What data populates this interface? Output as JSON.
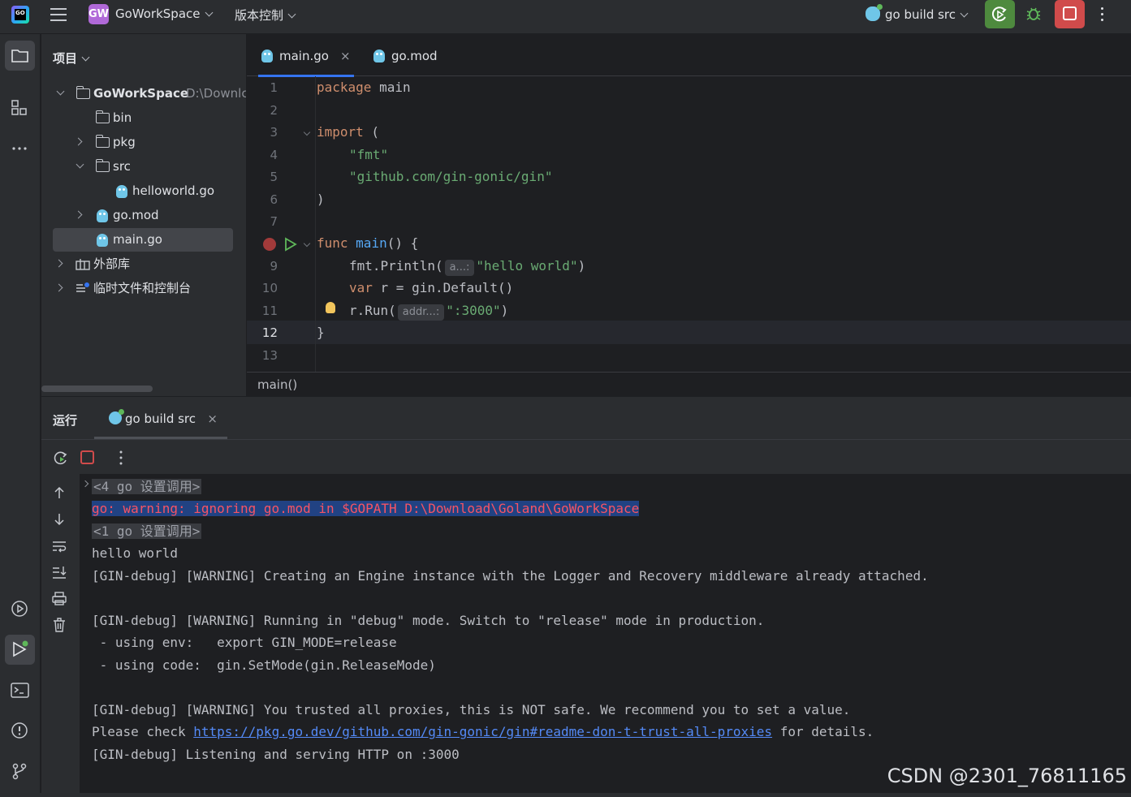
{
  "topbar": {
    "app_logo_text": "GO",
    "project_badge": "GW",
    "project_name": "GoWorkSpace",
    "vcs_menu": "版本控制",
    "run_config": "go build src"
  },
  "sidebar_left": {
    "icons": [
      "folder-icon",
      "structure-icon",
      "more-icon",
      "services-icon",
      "run-icon",
      "terminal-icon",
      "problems-icon",
      "git-icon"
    ]
  },
  "project_panel": {
    "title": "项目",
    "tree": [
      {
        "label": "GoWorkSpace",
        "hint": "D:\\Downlc",
        "type": "folder",
        "expanded": true
      },
      {
        "label": "bin",
        "type": "folder"
      },
      {
        "label": "pkg",
        "type": "folder",
        "collapsed": true
      },
      {
        "label": "src",
        "type": "folder",
        "expanded": true
      },
      {
        "label": "helloworld.go",
        "type": "gofile"
      },
      {
        "label": "go.mod",
        "type": "gomod",
        "collapsed": true
      },
      {
        "label": "main.go",
        "type": "gofile",
        "selected": true
      },
      {
        "label": "外部库",
        "type": "library"
      },
      {
        "label": "临时文件和控制台",
        "type": "scratch"
      }
    ]
  },
  "editor": {
    "tabs": [
      {
        "label": "main.go",
        "close": "×",
        "active": true
      },
      {
        "label": "go.mod",
        "active": false
      }
    ],
    "line_numbers": [
      "1",
      "2",
      "3",
      "4",
      "5",
      "6",
      "7",
      "8",
      "9",
      "10",
      "11",
      "12",
      "13"
    ],
    "code": {
      "l1_kw": "package",
      "l1_name": " main",
      "l3_kw": "import",
      "l3_rest": " (",
      "l4": "\"fmt\"",
      "l5": "\"github.com/gin-gonic/gin\"",
      "l6": ")",
      "l8_kw": "func",
      "l8_fn": "main",
      "l8_rest": "() {",
      "l9_call": "fmt.Println(",
      "l9_hint": "a...:",
      "l9_str": "\"hello world\"",
      "l9_end": ")",
      "l10_kw": "var",
      "l10_rest": " r = gin.Default()",
      "l11_call": "r.Run(",
      "l11_hint": "addr...:",
      "l11_str": "\":3000\"",
      "l11_end": ")",
      "l12": "}"
    },
    "breadcrumb": "main()"
  },
  "run_panel": {
    "title": "运行",
    "tab_label": "go build src",
    "tab_close": "×",
    "console": {
      "fold1": "<4 go 设置调用>",
      "warning": "go: warning: ignoring go.mod in $GOPATH D:\\Download\\Goland\\GoWorkSpace",
      "fold2": "<1 go 设置调用>",
      "line_hello": "hello world",
      "line_gin1": "[GIN-debug] [WARNING] Creating an Engine instance with the Logger and Recovery middleware already attached.",
      "line_gin2": "[GIN-debug] [WARNING] Running in \"debug\" mode. Switch to \"release\" mode in production.",
      "line_env": " - using env:   export GIN_MODE=release",
      "line_code": " - using code:  gin.SetMode(gin.ReleaseMode)",
      "line_gin3": "[GIN-debug] [WARNING] You trusted all proxies, this is NOT safe. We recommend you to set a value.",
      "line_check_pre": "Please check ",
      "line_check_link": "https://pkg.go.dev/github.com/gin-gonic/gin#readme-don-t-trust-all-proxies",
      "line_check_post": " for details.",
      "line_listen": "[GIN-debug] Listening and serving HTTP on :3000"
    }
  },
  "watermark": "CSDN @2301_76811165",
  "colors": {
    "accent": "#3574f0",
    "rerun": "#4e8a3e",
    "stop": "#d04b4b",
    "keyword": "#cf8e6d",
    "string": "#6aab73",
    "function": "#56a8f5",
    "error": "#f75464",
    "link": "#548af7"
  }
}
